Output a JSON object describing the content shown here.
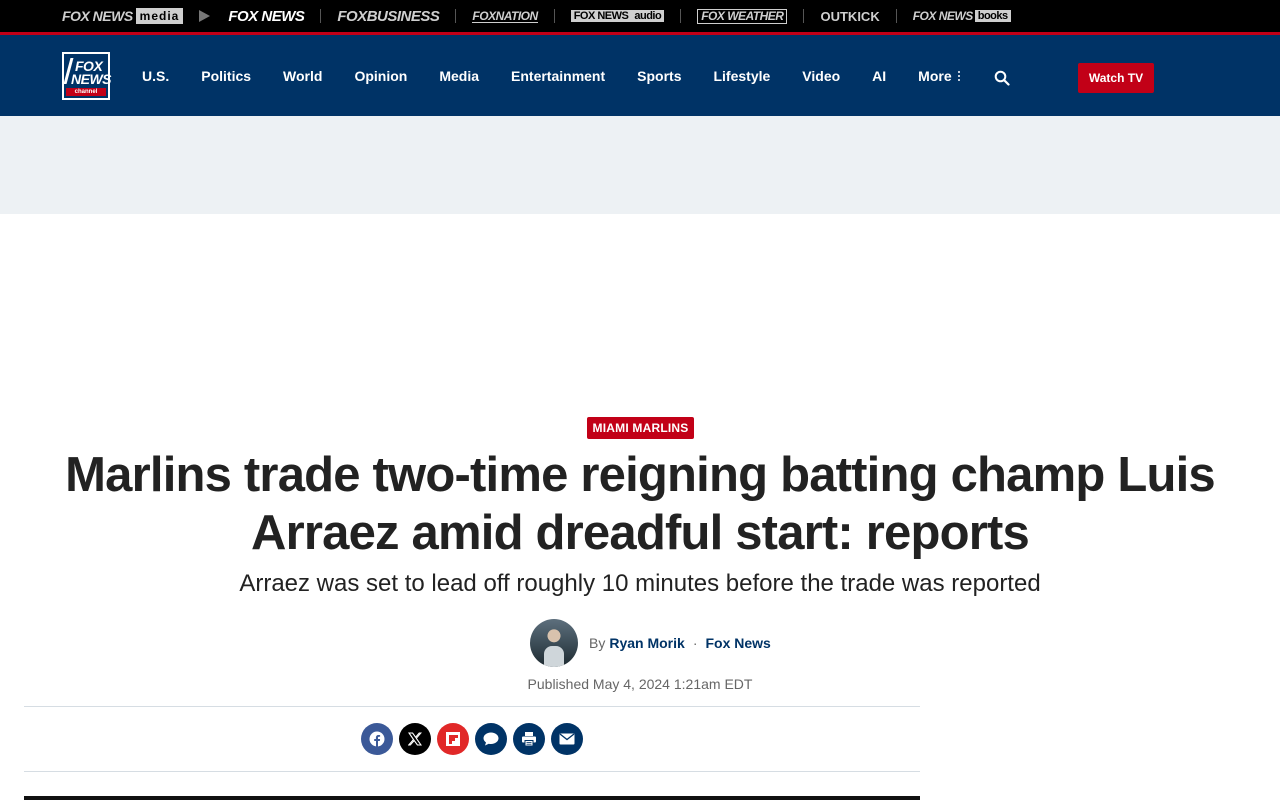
{
  "network_bar": {
    "brands": [
      {
        "part1": "FOX NEWS",
        "part2": "media"
      },
      {
        "label": "FOX NEWS"
      },
      {
        "label": "FOXBUSINESS"
      },
      {
        "label": "FOXNATION"
      },
      {
        "part1": "FOX NEWS",
        "part2": "audio"
      },
      {
        "label": "FOX WEATHER"
      },
      {
        "label": "OUTKICK"
      },
      {
        "part1": "FOX NEWS",
        "part2": "books"
      }
    ]
  },
  "header": {
    "logo": {
      "line1": "FOX",
      "line2": "NEWS",
      "line3": "channel"
    },
    "nav": [
      "U.S.",
      "Politics",
      "World",
      "Opinion",
      "Media",
      "Entertainment",
      "Sports",
      "Lifestyle",
      "Video",
      "AI"
    ],
    "more_label": "More",
    "watch_tv_label": "Watch TV"
  },
  "article": {
    "eyebrow": "MIAMI MARLINS",
    "headline": "Marlins trade two-time reigning batting champ Luis Arraez amid dreadful start: reports",
    "subheadline": "Arraez was set to lead off roughly 10 minutes before the trade was reported",
    "byline_prefix": "By",
    "author": "Ryan Morik",
    "separator": "·",
    "source": "Fox News",
    "published_label": "Published",
    "published_date": "May 4, 2024 1:21am EDT"
  },
  "share": {
    "buttons": [
      {
        "name": "facebook",
        "icon": "facebook-icon"
      },
      {
        "name": "twitter",
        "icon": "x-icon"
      },
      {
        "name": "flipboard",
        "icon": "flipboard-icon"
      },
      {
        "name": "comments",
        "icon": "comment-icon"
      },
      {
        "name": "print",
        "icon": "print-icon"
      },
      {
        "name": "email",
        "icon": "email-icon"
      }
    ]
  },
  "colors": {
    "header_bg": "#003366",
    "accent_red": "#c20017",
    "ad_bg": "#edf1f4",
    "text_dark": "#222222"
  }
}
